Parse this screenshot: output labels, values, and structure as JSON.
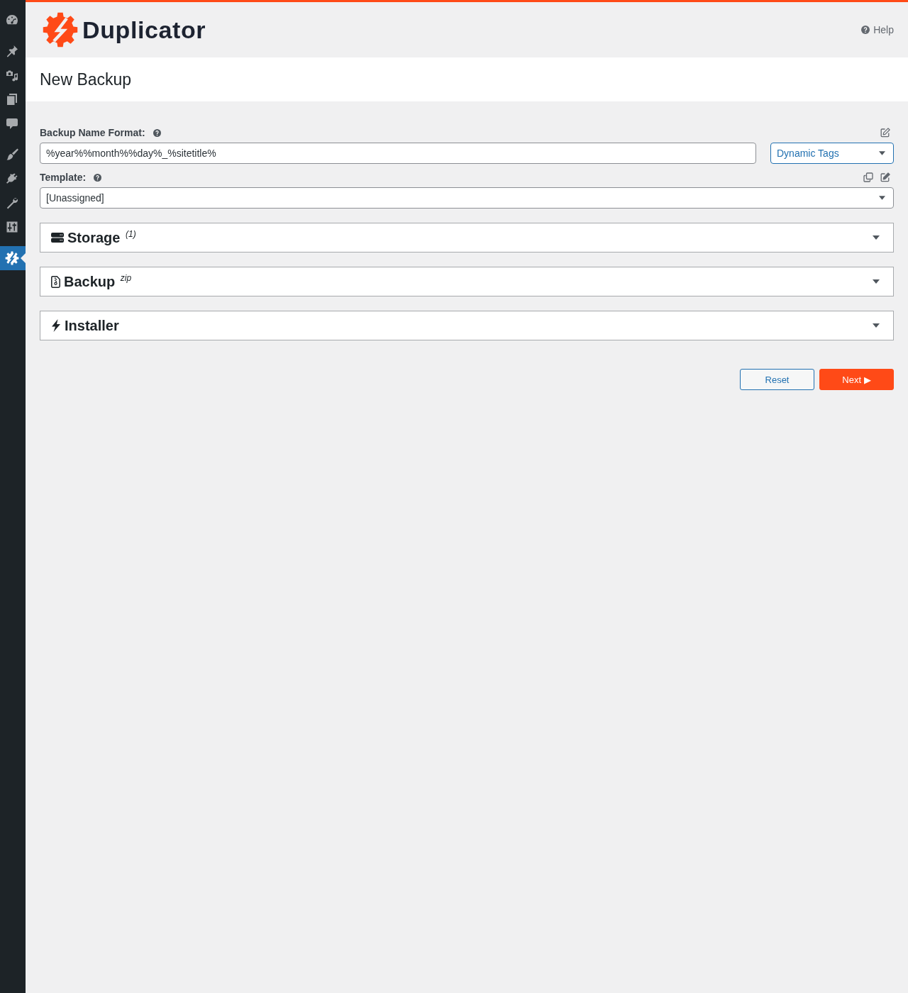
{
  "sidebar": {
    "groups": [
      {
        "items": [
          {
            "kind": "dashboard",
            "selected": false
          }
        ]
      },
      {
        "items": [
          {
            "kind": "posts",
            "selected": false
          },
          {
            "kind": "media",
            "selected": false
          },
          {
            "kind": "pages",
            "selected": false
          },
          {
            "kind": "comments",
            "selected": false
          }
        ]
      },
      {
        "items": [
          {
            "kind": "appearance",
            "selected": false
          },
          {
            "kind": "plugins",
            "selected": false
          },
          {
            "kind": "tools",
            "selected": false
          },
          {
            "kind": "settings",
            "selected": false
          }
        ]
      },
      {
        "items": [
          {
            "kind": "duplicator",
            "selected": true
          }
        ]
      }
    ]
  },
  "header": {
    "logo_text": "Duplicator",
    "help": "Help"
  },
  "page_title": "New Backup",
  "name_format": {
    "label": "Backup Name Format:",
    "value": "%year%%month%%day%_%sitetitle%",
    "tags_dropdown": "Dynamic Tags"
  },
  "template": {
    "label": "Template:",
    "value": "[Unassigned]"
  },
  "panels": [
    {
      "kind": "storage",
      "title": "Storage $^{(1)}$",
      "expanded": false
    },
    {
      "kind": "backup",
      "title": "Backup $^{zip}$",
      "expanded": false
    },
    {
      "kind": "installer",
      "title": "Installer",
      "expanded": false
    }
  ],
  "buttons": [
    {
      "kind": "secondary",
      "label": "Reset"
    },
    {
      "kind": "primary",
      "label": "Next ▶"
    }
  ]
}
